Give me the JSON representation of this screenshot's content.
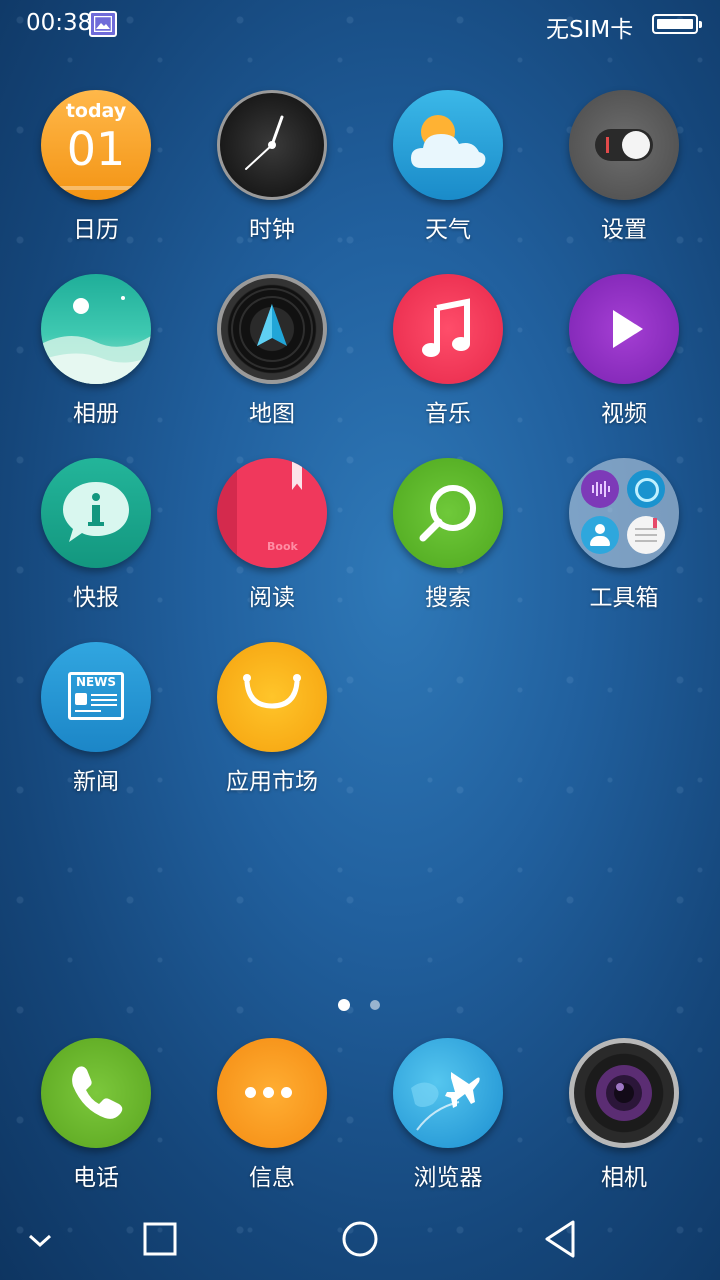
{
  "status_bar": {
    "time": "00:38",
    "carrier": "无SIM卡"
  },
  "calendar_icon": {
    "weekday": "today",
    "day": "01"
  },
  "book_icon": {
    "text": "Book"
  },
  "news_icon": {
    "text": "NEWS"
  },
  "apps": [
    {
      "label": "日历"
    },
    {
      "label": "时钟"
    },
    {
      "label": "天气"
    },
    {
      "label": "设置"
    },
    {
      "label": "相册"
    },
    {
      "label": "地图"
    },
    {
      "label": "音乐"
    },
    {
      "label": "视频"
    },
    {
      "label": "快报"
    },
    {
      "label": "阅读"
    },
    {
      "label": "搜索"
    },
    {
      "label": "工具箱"
    },
    {
      "label": "新闻"
    },
    {
      "label": "应用市场"
    }
  ],
  "dock": [
    {
      "label": "电话"
    },
    {
      "label": "信息"
    },
    {
      "label": "浏览器"
    },
    {
      "label": "相机"
    }
  ],
  "page_indicator": {
    "current": 1,
    "total": 2
  },
  "colors": {
    "wallpaper": "#21609e",
    "label_text": "#ffffff"
  }
}
